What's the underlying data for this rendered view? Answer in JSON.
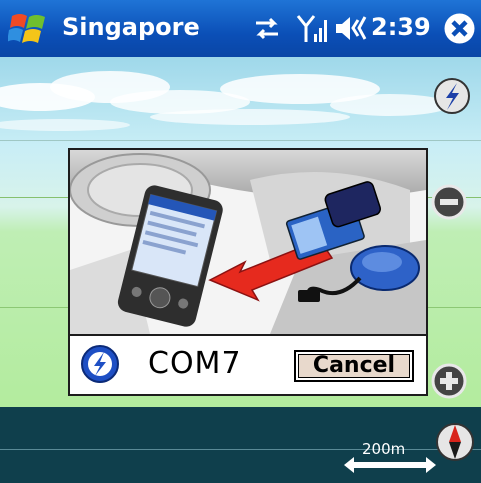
{
  "titlebar": {
    "title": "Singapore",
    "time": "2:39",
    "icons": [
      "windows-start-icon",
      "sync-icon",
      "signal-icon",
      "volume-icon",
      "close-icon"
    ]
  },
  "map": {
    "buttons": [
      "direction-icon",
      "zoom-out-icon",
      "zoom-in-icon"
    ]
  },
  "dialog": {
    "port": "COM7",
    "cancel_label": "Cancel",
    "illustration": "gps-device-connection-illustration"
  },
  "bottombar": {
    "scale": "200m",
    "compass_icon": "compass-icon"
  },
  "colors": {
    "title_bar": "#0b4fb7",
    "map_sky": "#bfe8f2",
    "map_ground": "#b3ec9e",
    "bottom_bar": "#0f3f4c",
    "arrow": "#e62a1e"
  }
}
